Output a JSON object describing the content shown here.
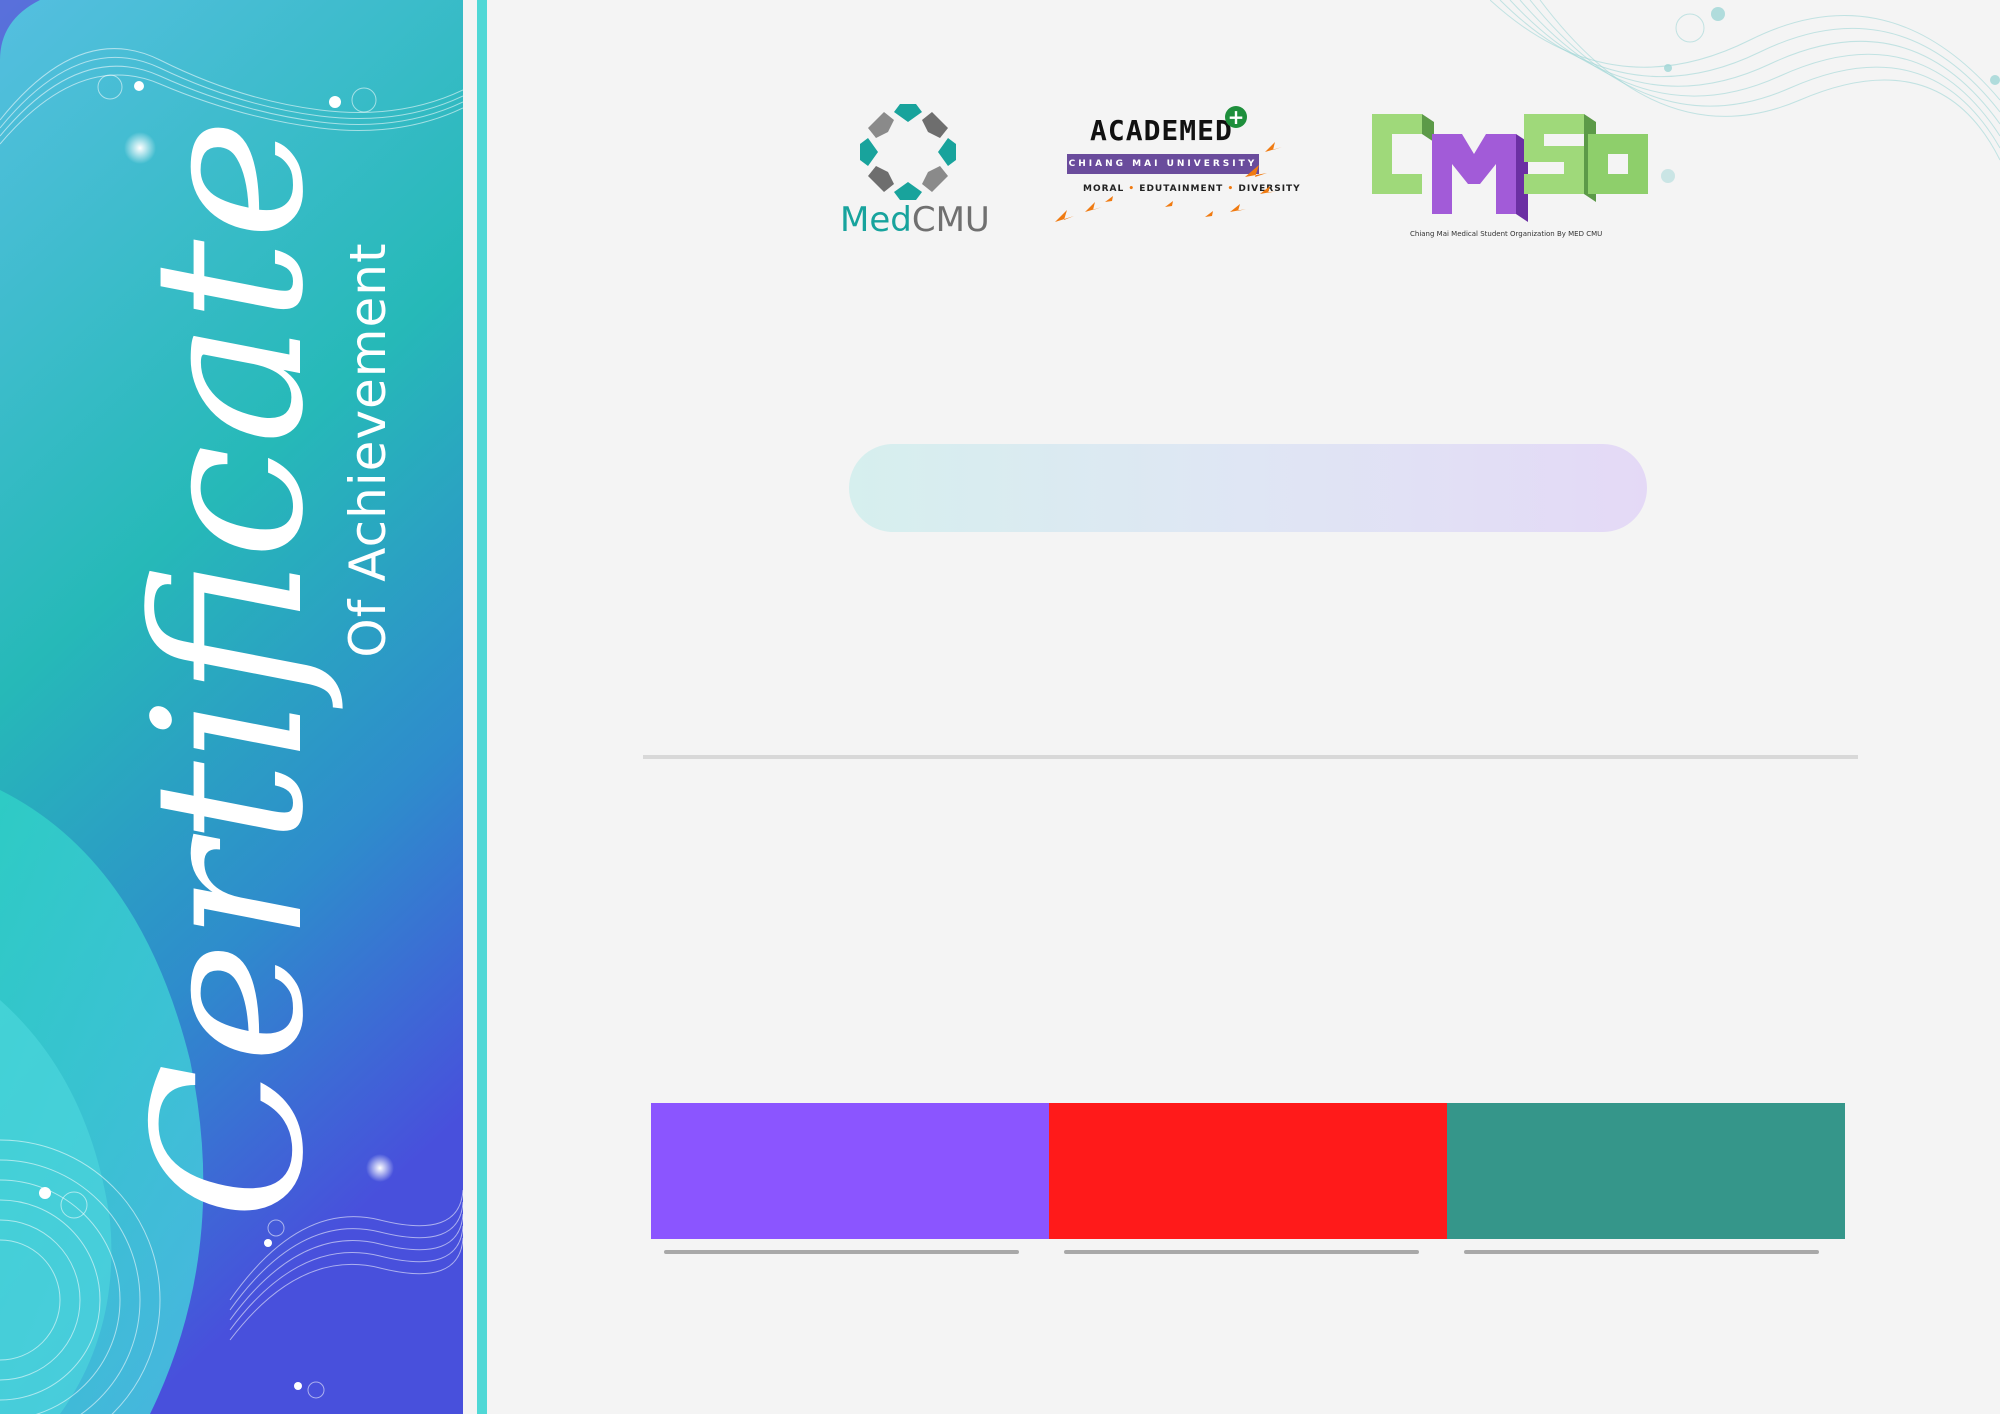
{
  "certificate": {
    "title_script": "Certificate",
    "subtitle": "Of Achievement"
  },
  "logos": {
    "medcmu": {
      "part1": "Med",
      "part2": "CMU",
      "icon": "medcmu-flower-icon"
    },
    "academed": {
      "title": "ACADEMED",
      "badge": "+",
      "university": "CHIANG MAI UNIVERSITY",
      "motto_1": "MORAL",
      "motto_2": "EDUTAINMENT",
      "motto_3": "DIVERSITY"
    },
    "cmso": {
      "letters": "CMSO",
      "caption": "Chiang Mai Medical Student Organization By MED CMU"
    }
  },
  "signature_blocks": [
    {
      "color": "#8b55ff"
    },
    {
      "color": "#ff1a1a"
    },
    {
      "color": "#35968a"
    }
  ],
  "colors": {
    "sidebar_top": "#55bfe0",
    "sidebar_mid": "#2cc3bd",
    "sidebar_bottom": "#4850dc",
    "stripe": "#4fd8d6",
    "background": "#f4f4f4"
  }
}
